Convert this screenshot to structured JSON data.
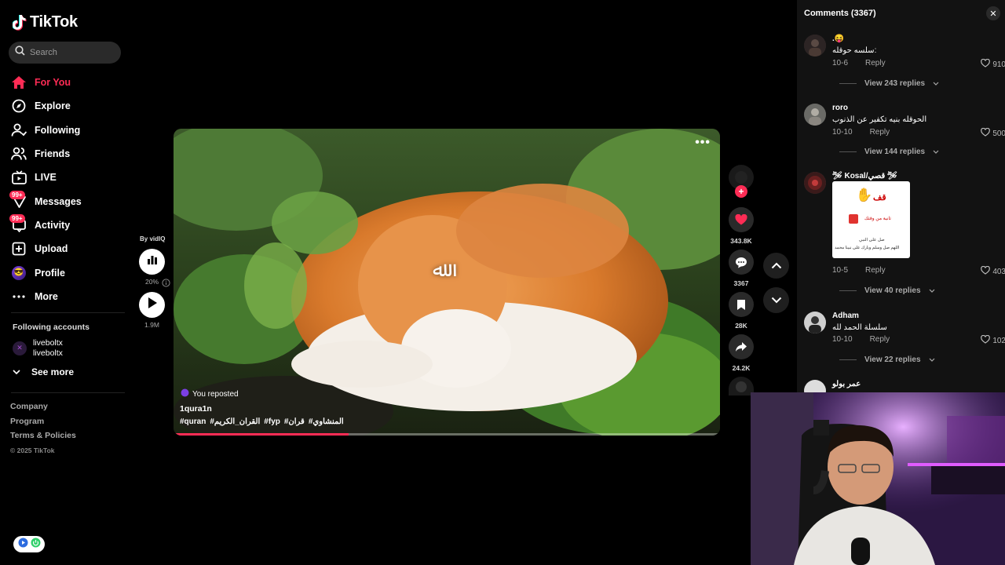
{
  "app": {
    "name": "TikTok"
  },
  "search": {
    "placeholder": "Search"
  },
  "nav": [
    {
      "label": "For You",
      "icon": "home-icon",
      "active": true
    },
    {
      "label": "Explore",
      "icon": "compass-icon"
    },
    {
      "label": "Following",
      "icon": "following-icon"
    },
    {
      "label": "Friends",
      "icon": "friends-icon"
    },
    {
      "label": "LIVE",
      "icon": "live-icon"
    },
    {
      "label": "Messages",
      "icon": "messages-icon",
      "badge": "99+"
    },
    {
      "label": "Activity",
      "icon": "activity-icon",
      "badge": "99+"
    },
    {
      "label": "Upload",
      "icon": "upload-icon"
    },
    {
      "label": "Profile",
      "icon": "profile-avatar"
    },
    {
      "label": "More",
      "icon": "more-icon"
    }
  ],
  "following_accounts": {
    "title": "Following accounts",
    "accounts": [
      {
        "name": "liveboltx",
        "handle": "liveboltx"
      }
    ],
    "see_more": "See more"
  },
  "footer": {
    "links": [
      "Company",
      "Program",
      "Terms & Policies"
    ],
    "copyright": "© 2025 TikTok"
  },
  "vidiq": {
    "by": "By vidIQ",
    "score": "20%",
    "plays": "1.9M"
  },
  "video": {
    "repost_label": "You reposted",
    "author": "1qura1n",
    "overlay_text": "ﷲ",
    "hashtags": [
      "#quran",
      "#القران_الكريم",
      "#fyp",
      "#قران",
      "#المنشاوي"
    ],
    "progress": 0.32
  },
  "actions": {
    "likes": "343.8K",
    "comments": "3367",
    "saves": "28K",
    "shares": "24.2K"
  },
  "comments_panel": {
    "title": "Comments (3367)",
    "comments": [
      {
        "name": ".😝",
        "text": "سلسه حوقله:",
        "date": "10-6",
        "reply": "Reply",
        "likes": "910",
        "view_replies": "View 243 replies"
      },
      {
        "name": "roro",
        "text": "الحوقله بنيه تكفير عن الذنوب",
        "date": "10-10",
        "reply": "Reply",
        "likes": "500",
        "view_replies": "View 144 replies"
      },
      {
        "name": "🛩 Kosal/قصي 🛩",
        "text": "",
        "date": "10-5",
        "reply": "Reply",
        "likes": "403",
        "view_replies": "View 40 replies",
        "sticker": {
          "title": "قف",
          "line1": "ثانية من وقتك",
          "line2": "صل على النبي",
          "line3": "اللهم صل وسلم وبارك على نبينا محمد"
        }
      },
      {
        "name": "Adham",
        "text": "سلسلة الحمد لله",
        "date": "10-10",
        "reply": "Reply",
        "likes": "102",
        "view_replies": "View 22 replies"
      },
      {
        "name": "عمر بولو",
        "text": ""
      }
    ]
  },
  "colors": {
    "accent": "#fe2c55",
    "panel": "#121212",
    "background": "#000000"
  }
}
